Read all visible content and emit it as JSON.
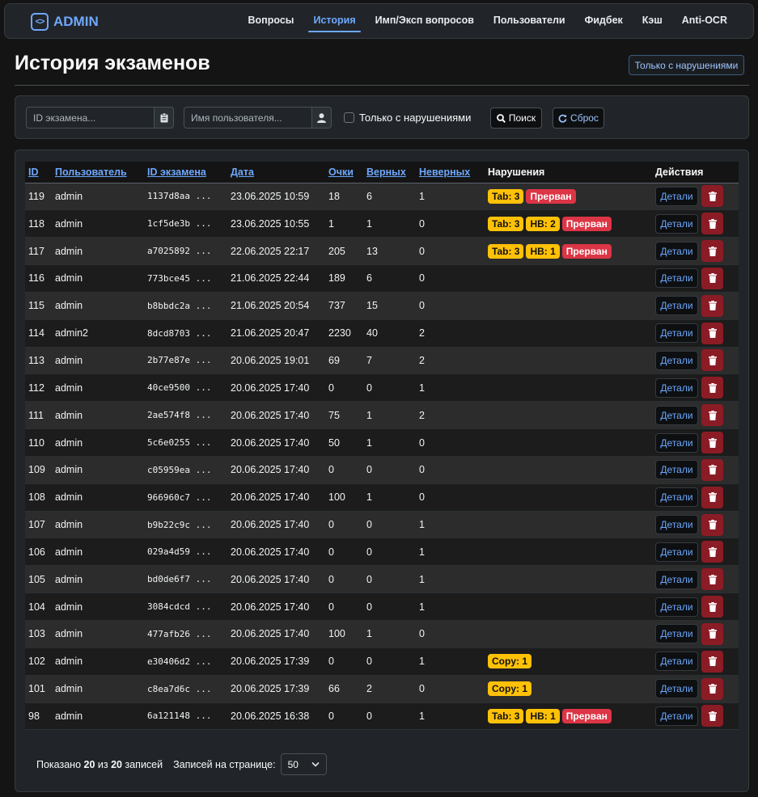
{
  "nav": {
    "brand": "ADMIN",
    "brand_icon": "code-brackets-icon",
    "items": [
      {
        "label": "Вопросы",
        "active": false
      },
      {
        "label": "История",
        "active": true
      },
      {
        "label": "Имп/Эксп вопросов",
        "active": false
      },
      {
        "label": "Пользователи",
        "active": false
      },
      {
        "label": "Фидбек",
        "active": false
      },
      {
        "label": "Кэш",
        "active": false
      },
      {
        "label": "Anti-OCR",
        "active": false
      }
    ]
  },
  "header": {
    "title": "История экзаменов",
    "violations_only_button": "Только с нарушениями"
  },
  "filters": {
    "exam_id_placeholder": "ID экзамена...",
    "exam_id_icon": "clipboard-icon",
    "username_placeholder": "Имя пользователя...",
    "username_icon": "user-icon",
    "violations_checkbox_label": "Только с нарушениями",
    "violations_checked": false,
    "search_button": "Поиск",
    "reset_button": "Сброс"
  },
  "table": {
    "columns": [
      "ID",
      "Пользователь",
      "ID экзамена",
      "Дата",
      "Очки",
      "Верных",
      "Неверных",
      "Нарушения",
      "Действия"
    ],
    "details_label": "Детали",
    "rows": [
      {
        "id": "119",
        "user": "admin",
        "exam": "1137d8aa ...",
        "date": "23.06.2025 10:59",
        "score": "18",
        "correct": "6",
        "wrong": "1",
        "violations": [
          {
            "text": "Tab: 3",
            "kind": "warn"
          },
          {
            "text": "Прерван",
            "kind": "danger"
          }
        ]
      },
      {
        "id": "118",
        "user": "admin",
        "exam": "1cf5de3b ...",
        "date": "23.06.2025 10:55",
        "score": "1",
        "correct": "1",
        "wrong": "0",
        "violations": [
          {
            "text": "Tab: 3",
            "kind": "warn"
          },
          {
            "text": "HB: 2",
            "kind": "warn"
          },
          {
            "text": "Прерван",
            "kind": "danger"
          }
        ]
      },
      {
        "id": "117",
        "user": "admin",
        "exam": "a7025892 ...",
        "date": "22.06.2025 22:17",
        "score": "205",
        "correct": "13",
        "wrong": "0",
        "violations": [
          {
            "text": "Tab: 3",
            "kind": "warn"
          },
          {
            "text": "HB: 1",
            "kind": "warn"
          },
          {
            "text": "Прерван",
            "kind": "danger"
          }
        ]
      },
      {
        "id": "116",
        "user": "admin",
        "exam": "773bce45 ...",
        "date": "21.06.2025 22:44",
        "score": "189",
        "correct": "6",
        "wrong": "0",
        "violations": []
      },
      {
        "id": "115",
        "user": "admin",
        "exam": "b8bbdc2a ...",
        "date": "21.06.2025 20:54",
        "score": "737",
        "correct": "15",
        "wrong": "0",
        "violations": []
      },
      {
        "id": "114",
        "user": "admin2",
        "exam": "8dcd8703 ...",
        "date": "21.06.2025 20:47",
        "score": "2230",
        "correct": "40",
        "wrong": "2",
        "violations": []
      },
      {
        "id": "113",
        "user": "admin",
        "exam": "2b77e87e ...",
        "date": "20.06.2025 19:01",
        "score": "69",
        "correct": "7",
        "wrong": "2",
        "violations": []
      },
      {
        "id": "112",
        "user": "admin",
        "exam": "40ce9500 ...",
        "date": "20.06.2025 17:40",
        "score": "0",
        "correct": "0",
        "wrong": "1",
        "violations": []
      },
      {
        "id": "111",
        "user": "admin",
        "exam": "2ae574f8 ...",
        "date": "20.06.2025 17:40",
        "score": "75",
        "correct": "1",
        "wrong": "2",
        "violations": []
      },
      {
        "id": "110",
        "user": "admin",
        "exam": "5c6e0255 ...",
        "date": "20.06.2025 17:40",
        "score": "50",
        "correct": "1",
        "wrong": "0",
        "violations": []
      },
      {
        "id": "109",
        "user": "admin",
        "exam": "c05959ea ...",
        "date": "20.06.2025 17:40",
        "score": "0",
        "correct": "0",
        "wrong": "0",
        "violations": []
      },
      {
        "id": "108",
        "user": "admin",
        "exam": "966960c7 ...",
        "date": "20.06.2025 17:40",
        "score": "100",
        "correct": "1",
        "wrong": "0",
        "violations": []
      },
      {
        "id": "107",
        "user": "admin",
        "exam": "b9b22c9c ...",
        "date": "20.06.2025 17:40",
        "score": "0",
        "correct": "0",
        "wrong": "1",
        "violations": []
      },
      {
        "id": "106",
        "user": "admin",
        "exam": "029a4d59 ...",
        "date": "20.06.2025 17:40",
        "score": "0",
        "correct": "0",
        "wrong": "1",
        "violations": []
      },
      {
        "id": "105",
        "user": "admin",
        "exam": "bd0de6f7 ...",
        "date": "20.06.2025 17:40",
        "score": "0",
        "correct": "0",
        "wrong": "1",
        "violations": []
      },
      {
        "id": "104",
        "user": "admin",
        "exam": "3084cdcd ...",
        "date": "20.06.2025 17:40",
        "score": "0",
        "correct": "0",
        "wrong": "1",
        "violations": []
      },
      {
        "id": "103",
        "user": "admin",
        "exam": "477afb26 ...",
        "date": "20.06.2025 17:40",
        "score": "100",
        "correct": "1",
        "wrong": "0",
        "violations": []
      },
      {
        "id": "102",
        "user": "admin",
        "exam": "e30406d2 ...",
        "date": "20.06.2025 17:39",
        "score": "0",
        "correct": "0",
        "wrong": "1",
        "violations": [
          {
            "text": "Copy: 1",
            "kind": "warn"
          }
        ]
      },
      {
        "id": "101",
        "user": "admin",
        "exam": "c8ea7d6c ...",
        "date": "20.06.2025 17:39",
        "score": "66",
        "correct": "2",
        "wrong": "0",
        "violations": [
          {
            "text": "Copy: 1",
            "kind": "warn"
          }
        ]
      },
      {
        "id": "98",
        "user": "admin",
        "exam": "6a121148 ...",
        "date": "20.06.2025 16:38",
        "score": "0",
        "correct": "0",
        "wrong": "1",
        "violations": [
          {
            "text": "Tab: 3",
            "kind": "warn"
          },
          {
            "text": "HB: 1",
            "kind": "warn"
          },
          {
            "text": "Прерван",
            "kind": "danger"
          }
        ]
      }
    ]
  },
  "footer": {
    "shown_prefix": "Показано",
    "shown": "20",
    "of": "из",
    "total": "20",
    "records": "записей",
    "per_page_label": "Записей на странице:",
    "per_page": "50"
  },
  "colors": {
    "accent": "#6ea8fe",
    "warning": "#ffc107",
    "danger": "#dc3545",
    "delete": "#8b1c25"
  }
}
